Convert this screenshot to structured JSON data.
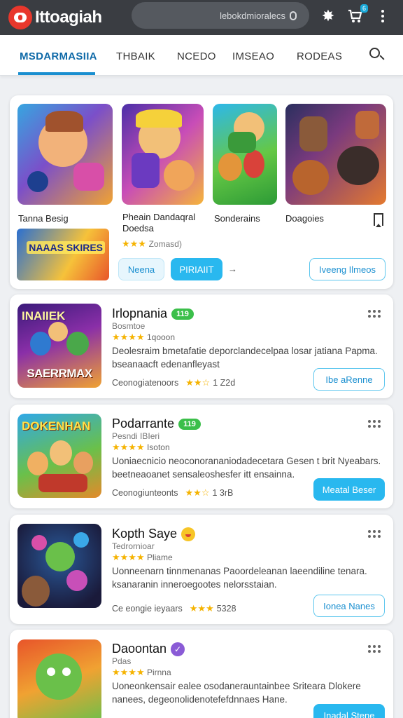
{
  "topbar": {
    "app_title": "Ittoagiah",
    "search_text": "lebokdmioralecs",
    "cart_badge": "6",
    "icons": [
      "logo-icon",
      "search-mic-icon",
      "star-badge-icon",
      "cart-icon",
      "kebab-menu-icon"
    ]
  },
  "tabs": [
    {
      "label": "MSDARMASIIA",
      "active": true
    },
    {
      "label": "THBAIK",
      "active": false
    },
    {
      "label": "NCEDO",
      "active": false
    },
    {
      "label": "IMSEAO",
      "active": false
    },
    {
      "label": "RODEAS",
      "active": false
    }
  ],
  "featured": {
    "labels": [
      "Tanna Besig",
      "Pheain Dandaqral",
      "Sonderains",
      "Doagoies"
    ],
    "subtitle": "Doedsa",
    "stars_text": "★★★",
    "rating_note": "Zomasd)",
    "mini_art_text": "NAAAS SKIRES",
    "buttons": {
      "outline": "Neena",
      "solid": "PIRIAIIT",
      "arrow": "→",
      "right": "Iveeng Ilmeos"
    }
  },
  "items": [
    {
      "title": "Irlopnania",
      "pill": "119",
      "sub": "Bosmtoe",
      "rating_text": "★★★★",
      "rating_count": "1qooon",
      "desc": "Deolesraim bmetafatie deporclandecelpaa losar jatiana Papma. bseanaacft edenanfleyast",
      "meta_label": "Ceonogiatenoors",
      "meta_stars": "★★☆",
      "meta_extra": "1 Z2d",
      "button": "Ibe aRenne",
      "button_style": "outline",
      "art_top": "INAIIEK",
      "art_caption": "SAERRMAX"
    },
    {
      "title": "Podarrante",
      "pill": "119",
      "sub": "Pesndi IBIeri",
      "rating_text": "★★★★",
      "rating_count": "Isoton",
      "desc": "Uoniaecnicio neoconorananiodadecetara Gesen t brit Nyeabars. beetneaoanet sensaleoshesfer itt ensainna.",
      "meta_label": "Ceonogiunteonts",
      "meta_stars": "★★☆",
      "meta_extra": "1 3rB",
      "button": "Meatal Beser",
      "button_style": "solid",
      "art_top": "DOKENHAN",
      "art_caption": ""
    },
    {
      "title": "Kopth Saye",
      "pill": "",
      "sub": "Tedrornioar",
      "rating_text": "★★★★",
      "rating_count": "Pliame",
      "desc": "Uonneenarn tinnmenanas Paoordeleanan laeendiline tenara. ksanaranin inneroegootes nelorsstaian.",
      "meta_label": "Ce eongie ieyaars",
      "meta_stars": "★★★",
      "meta_extra": "5328",
      "button": "Ionea Nanes",
      "button_style": "outline",
      "art_top": "",
      "art_caption": ""
    },
    {
      "title": "Daoontan",
      "pill": "",
      "sub": "Pdas",
      "rating_text": "★★★★",
      "rating_count": "Pirnna",
      "desc": "Uoneonkensair ealee osodanerauntainbee Sriteara Dlokere nanees, degeonolidenotefefdnnaes Hane.",
      "meta_label": "",
      "meta_stars": "★★☆",
      "meta_extra": "",
      "button": "Inadal Stene",
      "button_style": "solid",
      "art_top": "",
      "art_caption": ""
    }
  ]
}
